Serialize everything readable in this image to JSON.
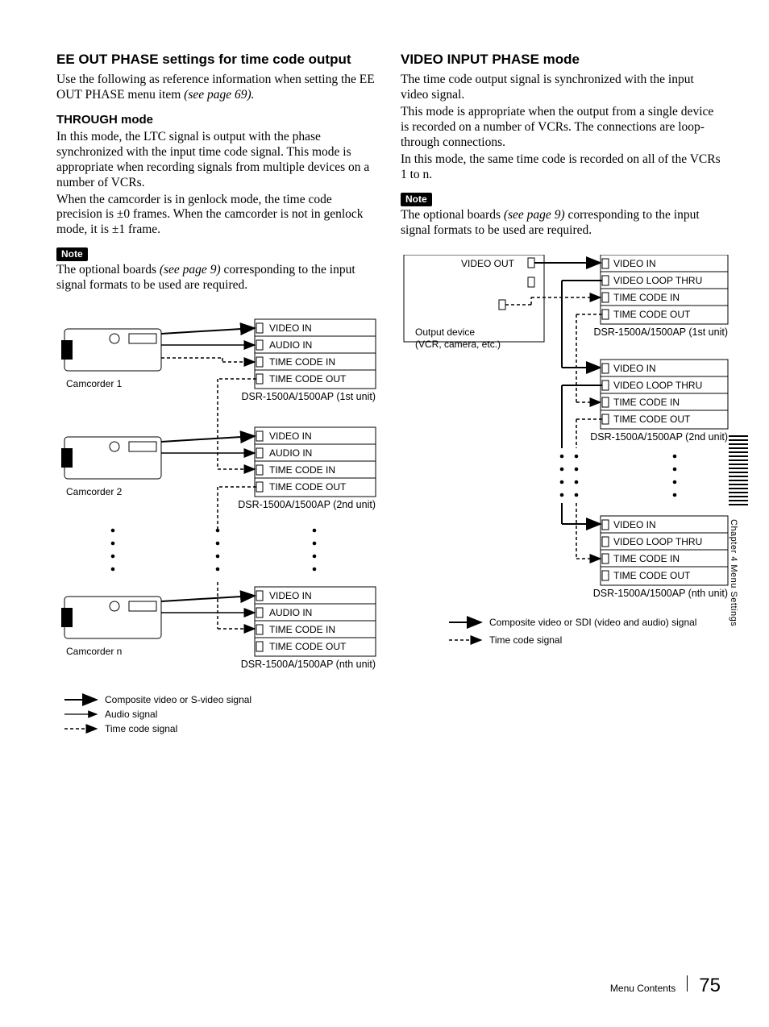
{
  "left": {
    "h2": "EE OUT PHASE settings for time code output",
    "p1a": "Use the following as reference information when setting the EE OUT PHASE menu item ",
    "p1b": "(see page 69).",
    "through_h": "THROUGH mode",
    "through_p1": "In this mode, the LTC signal is output with the phase synchronized with the input time code signal. This mode is appropriate when recording signals from multiple devices on a number of VCRs.",
    "through_p2": "When the camcorder is in genlock mode, the time code precision is ±0 frames. When the camcorder is not in genlock mode, it is ±1 frame.",
    "note_tag": "Note",
    "note_pa": "The optional boards ",
    "note_pb": "(see page 9)",
    "note_pc": " corresponding to the input signal formats to be used are required."
  },
  "right": {
    "h2": "VIDEO INPUT PHASE mode",
    "p1": "The time code output signal is synchronized with the input video signal.",
    "p2": "This mode is appropriate when the output from a single device is recorded on a number of VCRs. The connections are loop-through connections.",
    "p3": "In this mode, the same time code is recorded on all of the VCRs 1 to n.",
    "note_tag": "Note",
    "note_pa": "The optional boards ",
    "note_pb": "(see page 9)",
    "note_pc": " corresponding to the input signal formats to be used are required."
  },
  "diagram_left": {
    "cam1": "Camcorder 1",
    "cam2": "Camcorder 2",
    "camn": "Camcorder n",
    "box": {
      "video_in": "VIDEO IN",
      "audio_in": "AUDIO IN",
      "tc_in": "TIME CODE IN",
      "tc_out": "TIME CODE OUT"
    },
    "unit1": "DSR-1500A/1500AP (1st unit)",
    "unit2": "DSR-1500A/1500AP (2nd unit)",
    "unitn": "DSR-1500A/1500AP (nth unit)",
    "legend1": "Composite video or S-video signal",
    "legend2": "Audio signal",
    "legend3": "Time code signal"
  },
  "diagram_right": {
    "video_out": "VIDEO OUT",
    "output_device_l1": "Output device",
    "output_device_l2": "(VCR, camera, etc.)",
    "box": {
      "video_in": "VIDEO IN",
      "video_loop": "VIDEO LOOP THRU",
      "tc_in": "TIME CODE IN",
      "tc_out": "TIME CODE OUT"
    },
    "unit1": "DSR-1500A/1500AP (1st unit)",
    "unit2": "DSR-1500A/1500AP (2nd unit)",
    "unitn": "DSR-1500A/1500AP (nth unit)",
    "legend1": "Composite video or SDI (video and audio) signal",
    "legend2": "Time code signal"
  },
  "sidebar": "Chapter 4  Menu Settings",
  "footer": {
    "section": "Menu Contents",
    "page": "75"
  }
}
